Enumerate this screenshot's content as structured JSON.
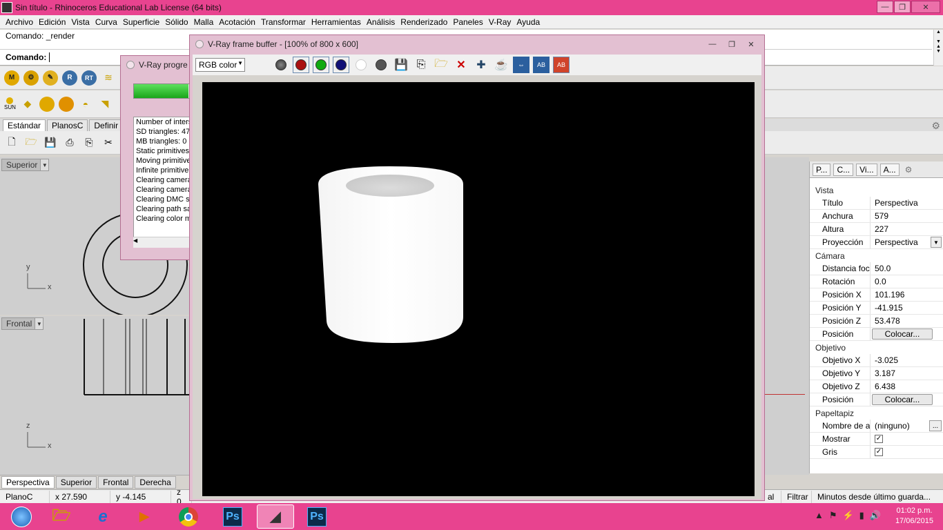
{
  "window": {
    "title": "Sin título - Rhinoceros Educational Lab License (64 bits)"
  },
  "menu": [
    "Archivo",
    "Edición",
    "Vista",
    "Curva",
    "Superficie",
    "Sólido",
    "Malla",
    "Acotación",
    "Transformar",
    "Herramientas",
    "Análisis",
    "Renderizado",
    "Paneles",
    "V-Ray",
    "Ayuda"
  ],
  "command": {
    "history": "Comando: _render",
    "prompt": "Comando:"
  },
  "toolbar2": {
    "sun_label": "SUN"
  },
  "toolbar_tabs": [
    "Estándar",
    "PlanosC",
    "Definir v"
  ],
  "viewports": {
    "top": "Superior",
    "front": "Frontal"
  },
  "axis_labels": {
    "y": "y",
    "x": "x",
    "z": "z"
  },
  "bottom_tabs": [
    "Perspectiva",
    "Superior",
    "Frontal",
    "Derecha"
  ],
  "status": {
    "cplane": "PlanoC",
    "x": "x 27.590",
    "y": "y -4.145",
    "z": "z 0",
    "right_fragment": "al",
    "filter": "Filtrar",
    "time": "Minutos desde último guarda..."
  },
  "vray_progress": {
    "title": "V-Ray progre",
    "log": [
      "Number of inters",
      "SD triangles: 47",
      "MB triangles: 0",
      "Static primitives",
      "Moving primitive",
      "Infinite primitive",
      "Clearing camera",
      "Clearing camera",
      "Clearing DMC sa",
      "Clearing path sa",
      "Clearing color m"
    ],
    "progress": 0.9
  },
  "vfb": {
    "title": "V-Ray frame buffer - [100% of 800 x 600]",
    "channel": "RGB color"
  },
  "properties": {
    "tabs": [
      "P...",
      "C...",
      "Vi...",
      "A..."
    ],
    "sections": {
      "vista": "Vista",
      "camara": "Cámara",
      "objetivo": "Objetivo",
      "papel": "Papeltapiz"
    },
    "vista_rows": [
      {
        "k": "Título",
        "v": "Perspectiva"
      },
      {
        "k": "Anchura",
        "v": "579"
      },
      {
        "k": "Altura",
        "v": "227"
      },
      {
        "k": "Proyección",
        "v": "Perspectiva"
      }
    ],
    "camara_rows": [
      {
        "k": "Distancia focal",
        "v": "50.0"
      },
      {
        "k": "Rotación",
        "v": "0.0"
      },
      {
        "k": "Posición X",
        "v": "101.196"
      },
      {
        "k": "Posición Y",
        "v": "-41.915"
      },
      {
        "k": "Posición Z",
        "v": "53.478"
      },
      {
        "k": "Posición",
        "v": "Colocar..."
      }
    ],
    "objetivo_rows": [
      {
        "k": "Objetivo X",
        "v": "-3.025"
      },
      {
        "k": "Objetivo Y",
        "v": "3.187"
      },
      {
        "k": "Objetivo Z",
        "v": "6.438"
      },
      {
        "k": "Posición",
        "v": "Colocar..."
      }
    ],
    "papel_rows": [
      {
        "k": "Nombre de ar...",
        "v": "(ninguno)",
        "btn": "..."
      },
      {
        "k": "Mostrar",
        "v": "✓"
      },
      {
        "k": "Gris",
        "v": "✓"
      }
    ]
  },
  "taskbar": {
    "ps": "Ps",
    "time": "01:02 p.m.",
    "date": "17/06/2015"
  },
  "colors": {
    "accent": "#e8438f",
    "green": "#1aa61a"
  }
}
